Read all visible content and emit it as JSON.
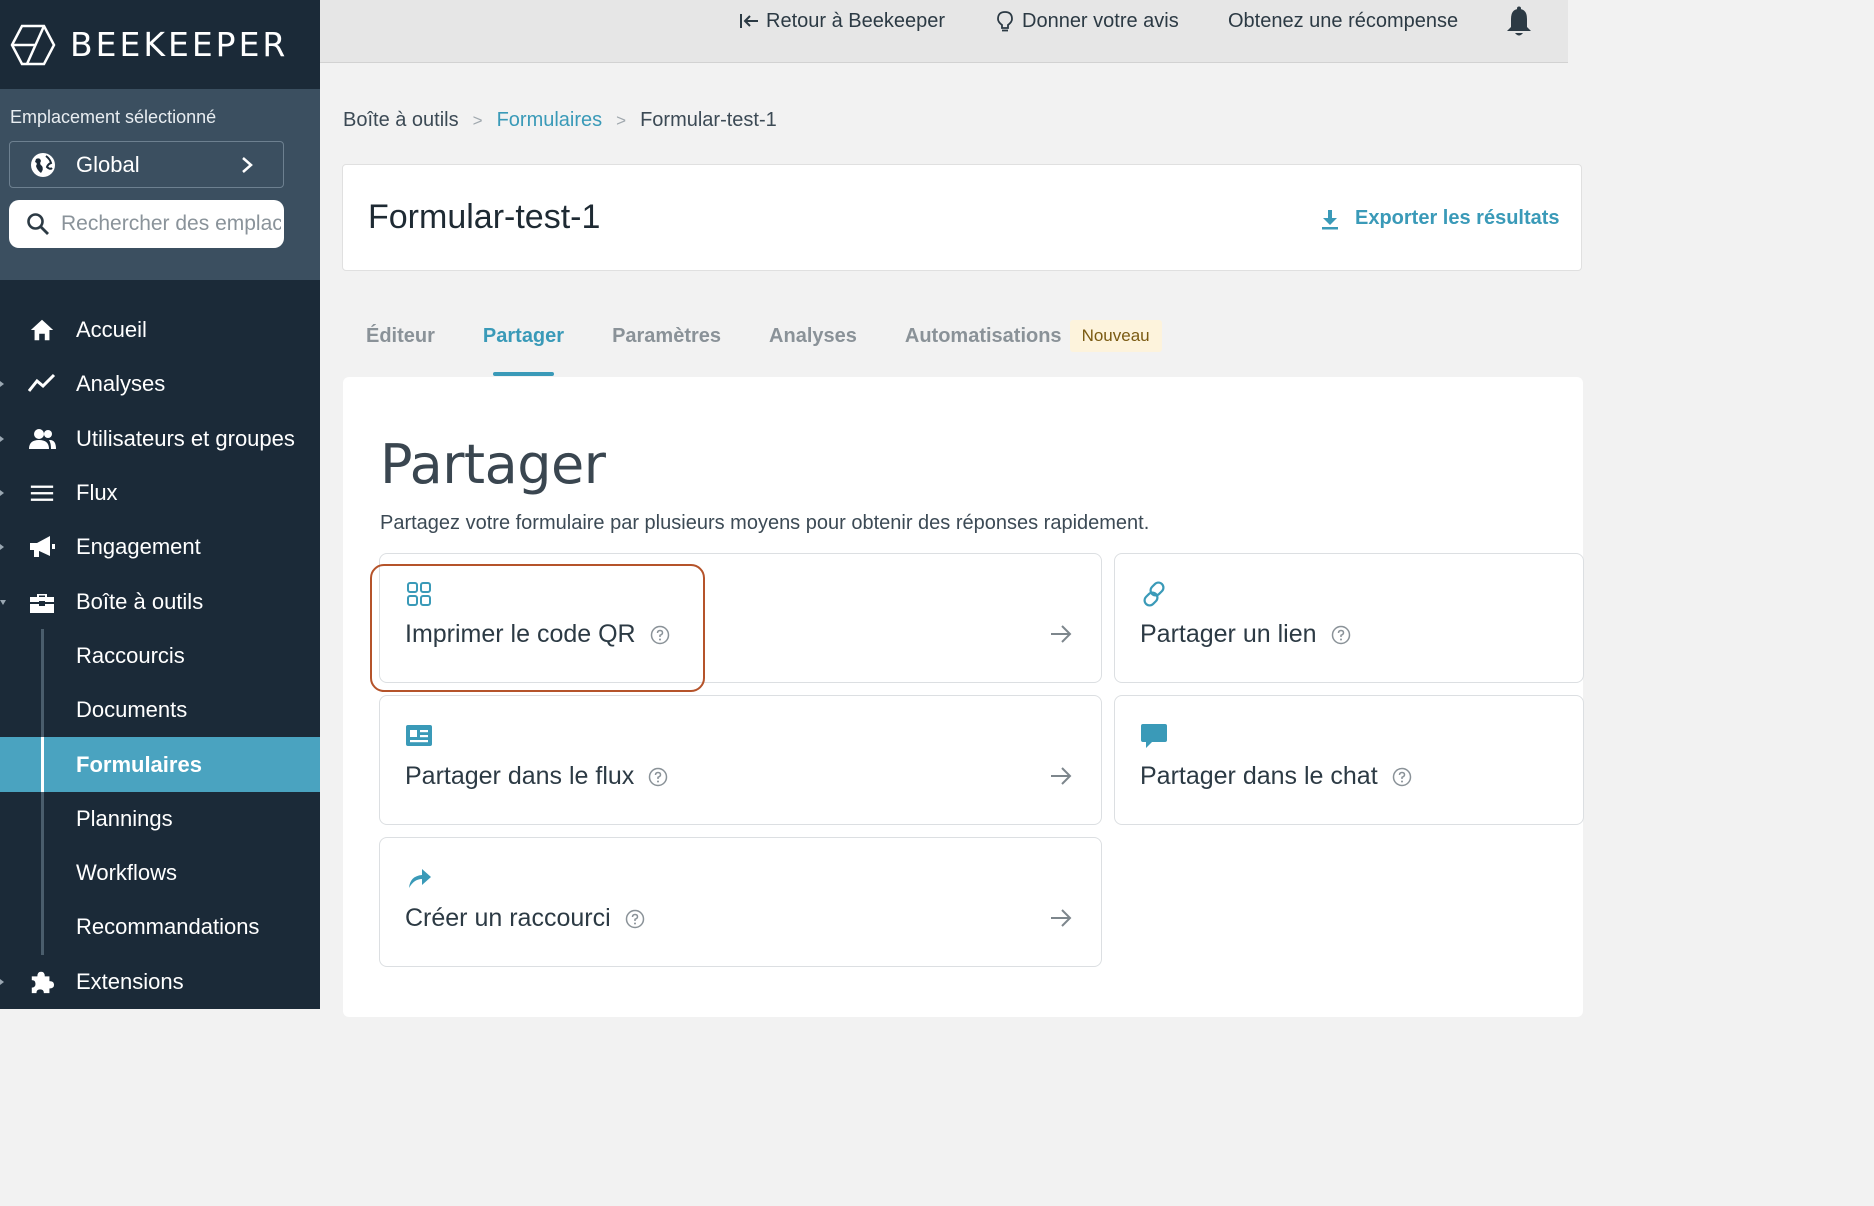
{
  "brand": {
    "name": "BEEKEEPER",
    "logo_icon": "hexagon-logo-icon"
  },
  "location": {
    "label": "Emplacement sélectionné",
    "selected": "Global",
    "search_placeholder": "Rechercher des emplac"
  },
  "nav": {
    "items": [
      {
        "label": "Accueil",
        "icon": "home-icon"
      },
      {
        "label": "Analyses",
        "icon": "chart-line-icon"
      },
      {
        "label": "Utilisateurs et groupes",
        "icon": "users-icon"
      },
      {
        "label": "Flux",
        "icon": "menu-lines-icon"
      },
      {
        "label": "Engagement",
        "icon": "megaphone-icon"
      },
      {
        "label": "Boîte à outils",
        "icon": "toolbox-icon"
      }
    ],
    "sub_items": [
      "Raccourcis",
      "Documents",
      "Formulaires",
      "Plannings",
      "Workflows",
      "Recommandations"
    ],
    "active_sub": "Formulaires",
    "extensions": {
      "label": "Extensions",
      "icon": "puzzle-icon"
    }
  },
  "topbar": {
    "back": "Retour à Beekeeper",
    "feedback": "Donner votre avis",
    "reward": "Obtenez une récompense"
  },
  "breadcrumb": [
    "Boîte à outils",
    "Formulaires",
    "Formular-test-1"
  ],
  "header": {
    "title": "Formular-test-1",
    "export": "Exporter les résultats"
  },
  "tabs": {
    "items": [
      "Éditeur",
      "Partager",
      "Paramètres",
      "Analyses",
      "Automatisations"
    ],
    "active": "Partager",
    "badge": "Nouveau"
  },
  "share": {
    "title": "Partager",
    "description": "Partagez votre formulaire par plusieurs moyens pour obtenir des réponses rapidement.",
    "options": [
      {
        "label": "Imprimer le code QR",
        "icon": "qr-grid-icon"
      },
      {
        "label": "Partager un lien",
        "icon": "link-icon"
      },
      {
        "label": "Partager dans le flux",
        "icon": "post-card-icon"
      },
      {
        "label": "Partager dans le chat",
        "icon": "chat-bubble-icon"
      },
      {
        "label": "Créer un raccourci",
        "icon": "share-arrow-icon"
      }
    ]
  },
  "colors": {
    "sidebar": "#1b2a38",
    "accent": "#3a9ab8",
    "active_nav": "#4aa3c0",
    "highlight": "#b5532a"
  }
}
